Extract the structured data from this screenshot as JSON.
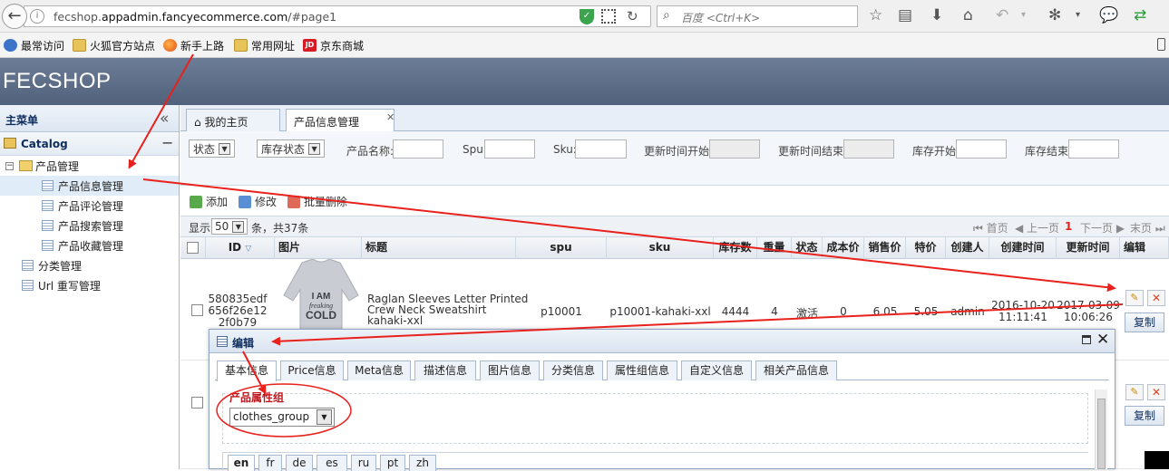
{
  "browser": {
    "url_prefix": "fecshop.",
    "url_domain": "appadmin.fancyecommerce.com",
    "url_path": "/#page1",
    "search_placeholder": "百度 <Ctrl+K>",
    "bookmarks": [
      "最常访问",
      "火狐官方站点",
      "新手上路",
      "常用网址",
      "京东商城"
    ],
    "jd_badge": "JD"
  },
  "app": {
    "logo": "FECSHOP"
  },
  "sidebar": {
    "title": "主菜单",
    "collapse": "«",
    "section": "Catalog",
    "section_toggle": "−",
    "tree": {
      "product_mgmt": "产品管理",
      "items": [
        "产品信息管理",
        "产品评论管理",
        "产品搜索管理",
        "产品收藏管理"
      ],
      "category_mgmt": "分类管理",
      "url_rewrite": "Url 重写管理"
    }
  },
  "tabs": [
    {
      "label": "我的主页"
    },
    {
      "label": "产品信息管理"
    }
  ],
  "tab_close": "✕",
  "filters": {
    "status": "状态",
    "stock_status": "库存状态",
    "product_name": "产品名称:",
    "spu": "Spu:",
    "sku": "Sku:",
    "update_start": "更新时间开始",
    "update_end": "更新时间结束",
    "stock_start": "库存开始",
    "stock_end": "库存结束"
  },
  "toolbar": {
    "add": "添加",
    "edit": "修改",
    "batch_delete": "批量删除"
  },
  "pager": {
    "show": "显示",
    "page_size": "50",
    "summary": "条，共37条",
    "first": "首页",
    "prev": "上一页",
    "current": "1",
    "next": "下一页",
    "last": "末页"
  },
  "columns": [
    "ID",
    "图片",
    "标题",
    "spu",
    "sku",
    "库存数",
    "重量",
    "状态",
    "成本价",
    "销售价",
    "特价",
    "创建人",
    "创建时间",
    "更新时间",
    "编辑"
  ],
  "rows": [
    {
      "id": [
        "580835edf",
        "656f26e12",
        "2f0b79"
      ],
      "image_text": [
        "I AM",
        "freaking",
        "COLD"
      ],
      "title": [
        "Raglan Sleeves Letter Printed",
        "Crew Neck Sweatshirt",
        "kahaki-xxl"
      ],
      "spu": "p10001",
      "sku": "p10001-kahaki-xxl",
      "qty": "4444",
      "weight": "4",
      "status": "激活",
      "cost": "0",
      "price": "6.05",
      "special": "5.05",
      "creator": "admin",
      "created": [
        "2016-10-20",
        "11:11:41"
      ],
      "updated": [
        "2017-03-09",
        "10:06:26"
      ],
      "copy": "复制"
    },
    {
      "copy": "复制"
    }
  ],
  "dialog": {
    "title": "编辑",
    "close": "✕",
    "tabs": [
      "基本信息",
      "Price信息",
      "Meta信息",
      "描述信息",
      "图片信息",
      "分类信息",
      "属性组信息",
      "自定义信息",
      "相关产品信息"
    ],
    "attr_group_label": "产品属性组",
    "attr_group_value": "clothes_group",
    "languages": [
      "en",
      "fr",
      "de",
      "es",
      "ru",
      "pt",
      "zh"
    ]
  },
  "colors": {
    "header": "#5e6e89",
    "accent_red": "#e8211c",
    "link": "#0e2d5f"
  },
  "icons": [
    "back-icon",
    "info-icon",
    "shield-icon",
    "qr-icon",
    "reload-icon",
    "search-icon",
    "star-icon",
    "reading-list-icon",
    "download-icon",
    "home-icon",
    "undo-icon",
    "gear-icon",
    "chat-icon",
    "sync-icon",
    "mobile-icon"
  ]
}
